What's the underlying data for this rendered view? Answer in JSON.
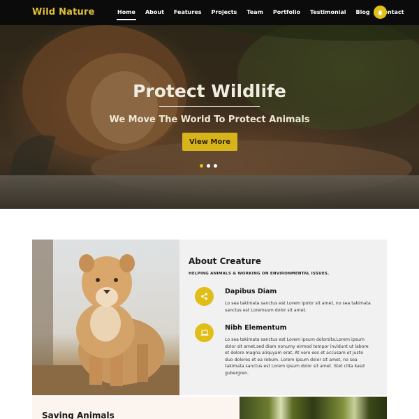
{
  "nav": {
    "brand": "Wild Nature",
    "items": [
      {
        "label": "Home",
        "active": true
      },
      {
        "label": "About"
      },
      {
        "label": "Features"
      },
      {
        "label": "Projects"
      },
      {
        "label": "Team"
      },
      {
        "label": "Portfolio"
      },
      {
        "label": "Testimonial"
      },
      {
        "label": "Blog"
      },
      {
        "label": "Contact"
      }
    ],
    "action_icon": "bell-icon"
  },
  "hero": {
    "title": "Protect Wildlife",
    "subtitle": "We Move The World To Protect Animals",
    "button": "View More",
    "slides": 3,
    "active_slide": 1
  },
  "about": {
    "title": "About Creature",
    "tagline": "HELPING ANIMALS & WORKING ON ENVIRONMENTAL ISSUES.",
    "features": [
      {
        "icon": "share-icon",
        "title": "Dapibus Diam",
        "text": "Lo sea takimata sanctus est Lorem ipolor sit amet, no sea takimata sanctus est Loremsum dolor sit amet."
      },
      {
        "icon": "laptop-icon",
        "title": "Nibh Elementum",
        "text": "Lo sea takimata sanctus est Lorem ipsum dolorsita.Lorem ipsum dolor sit amet,sed diam nonumy eirmod tempor invidunt ut labore et dolore magna aliquyam erat, At vero eos et accusam et justo duo dolores et ea rebum. Lorem ipsum dolor sit amet, no sea takimata sanctus est Lorem ipsum dolor sit amet. Stet clita kasd gubergren."
      }
    ]
  },
  "saving": {
    "title": "Saving Animals"
  },
  "colors": {
    "accent": "#e0bd17",
    "nav_bg": "#0b0b0b",
    "brand": "#e2c13a"
  }
}
